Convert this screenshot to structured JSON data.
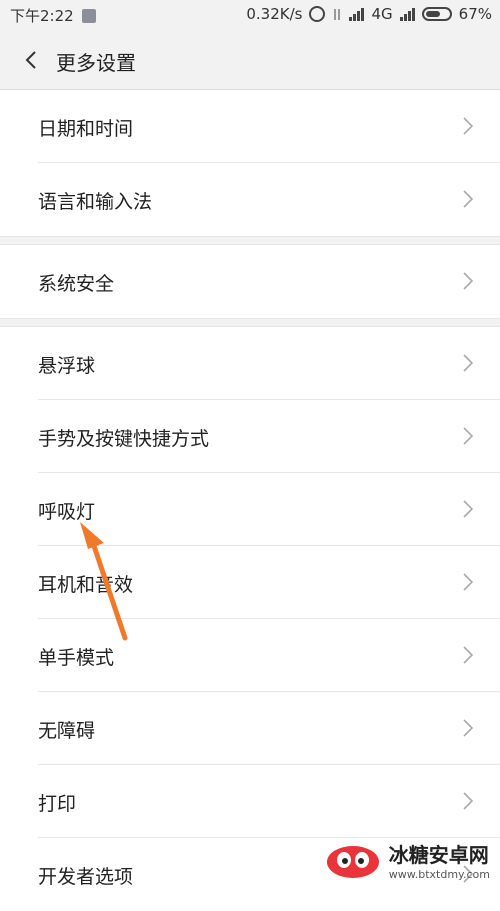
{
  "status_bar": {
    "time": "下午2:22",
    "speed": "0.32K/s",
    "network": "4G",
    "battery": "67%",
    "battery_level": 0.67
  },
  "header": {
    "title": "更多设置"
  },
  "sections": [
    {
      "items": [
        {
          "label": "日期和时间"
        },
        {
          "label": "语言和输入法"
        }
      ]
    },
    {
      "items": [
        {
          "label": "系统安全"
        }
      ]
    },
    {
      "items": [
        {
          "label": "悬浮球"
        },
        {
          "label": "手势及按键快捷方式"
        },
        {
          "label": "呼吸灯"
        },
        {
          "label": "耳机和音效"
        },
        {
          "label": "单手模式"
        },
        {
          "label": "无障碍"
        },
        {
          "label": "打印"
        },
        {
          "label": "开发者选项"
        }
      ]
    }
  ],
  "watermark": {
    "name": "冰糖安卓网",
    "url": "www.btxtdmy.com"
  },
  "colors": {
    "annotation_arrow": "#f07a2a",
    "background": "#f2f2f2"
  }
}
